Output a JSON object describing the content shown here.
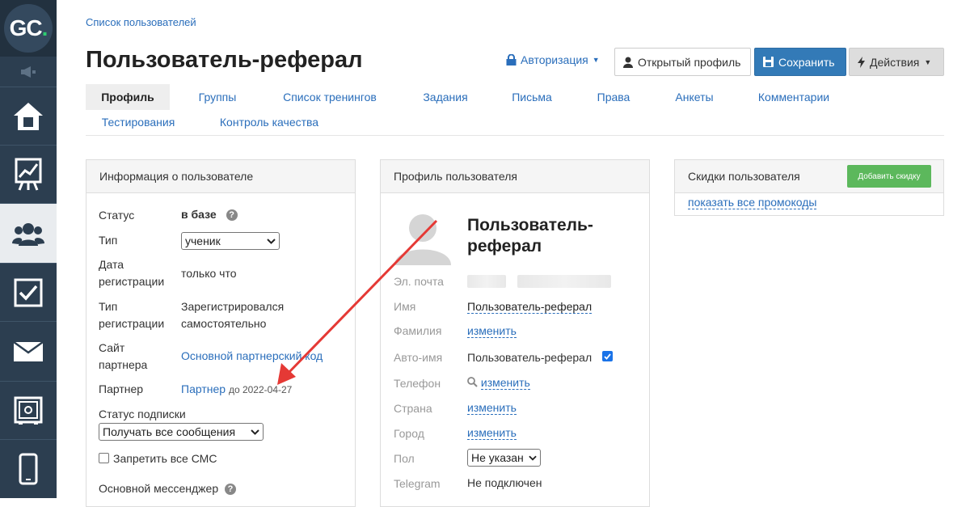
{
  "logo": {
    "text": "GC",
    "dot": "."
  },
  "header": {
    "breadcrumb": "Список пользователей",
    "title": "Пользователь-реферал",
    "auth_label": "Авторизация",
    "open_profile_label": "Открытый профиль",
    "save_label": "Сохранить",
    "actions_label": "Действия"
  },
  "tabs": [
    "Профиль",
    "Группы",
    "Список тренингов",
    "Задания",
    "Письма",
    "Права",
    "Анкеты",
    "Комментарии",
    "Тестирования",
    "Контроль качества"
  ],
  "info_panel": {
    "title": "Информация о пользователе",
    "status_label": "Статус",
    "status_value": "в базе",
    "type_label": "Тип",
    "type_value": "ученик",
    "reg_date_label": "Дата регистрации",
    "reg_date_value": "только что",
    "reg_type_label": "Тип регистрации",
    "reg_type_value": "Зарегистрировался самостоятельно",
    "site_label": "Сайт партнера",
    "site_value": "Основной партнерский код",
    "partner_label": "Партнер",
    "partner_value": "Партнер",
    "partner_until": "до 2022-04-27",
    "sub_status_label": "Статус подписки",
    "sub_status_value": "Получать все сообщения",
    "sms_label": "Запретить все СМС",
    "messenger_label": "Основной мессенджер"
  },
  "profile_panel": {
    "title": "Профиль пользователя",
    "name": "Пользователь-реферал",
    "email_label": "Эл. почта",
    "first_name_label": "Имя",
    "first_name_value": "Пользователь-реферал",
    "last_name_label": "Фамилия",
    "last_name_value": "изменить",
    "auto_name_label": "Авто-имя",
    "auto_name_value": "Пользователь-реферал",
    "phone_label": "Телефон",
    "phone_value": "изменить",
    "country_label": "Страна",
    "country_value": "изменить",
    "city_label": "Город",
    "city_value": "изменить",
    "gender_label": "Пол",
    "gender_value": "Не указан",
    "telegram_label": "Telegram",
    "telegram_value": "Не подключен"
  },
  "discount_panel": {
    "title": "Скидки пользователя",
    "add_label": "Добавить скидку",
    "promo_link": "показать все промокоды"
  },
  "colors": {
    "sidebar": "#2c3e50",
    "link": "#2a6ebb",
    "primary": "#337ab7",
    "success": "#5cb85c",
    "arrow": "#e53935"
  }
}
